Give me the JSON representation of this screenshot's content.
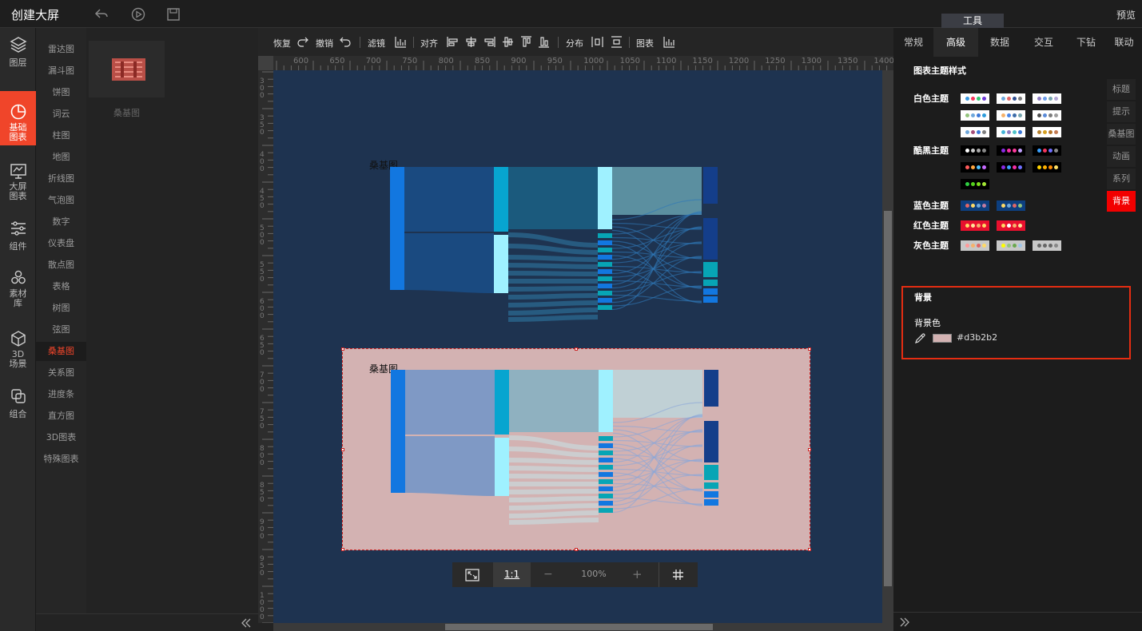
{
  "app": {
    "title": "创建大屏",
    "preview": "预览",
    "tool_tab": "工具"
  },
  "leftnav": [
    {
      "label": "图层",
      "icon": "layers-icon"
    },
    {
      "label": "基础图表",
      "icon": "pie-chart-icon"
    },
    {
      "label": "大屏图表",
      "icon": "monitor-chart-icon"
    },
    {
      "label": "组件",
      "icon": "sliders-icon"
    },
    {
      "label": "素材库",
      "icon": "hexagons-icon"
    },
    {
      "label": "3D场景",
      "icon": "cube-icon"
    },
    {
      "label": "组合",
      "icon": "group-icon"
    }
  ],
  "subnav": [
    "雷达图",
    "漏斗图",
    "饼图",
    "词云",
    "柱图",
    "地图",
    "折线图",
    "气泡图",
    "数字",
    "仪表盘",
    "散点图",
    "表格",
    "树图",
    "弦图",
    "桑基图",
    "关系图",
    "进度条",
    "直方图",
    "3D图表",
    "特殊图表"
  ],
  "subnav_active": "桑基图",
  "thumbnail": {
    "label": "桑基图"
  },
  "toolbar": {
    "redo": "恢复",
    "undo": "撤销",
    "filter": "滤镜",
    "align": "对齐",
    "distribute": "分布",
    "chart": "图表"
  },
  "ruler": {
    "top": [
      "600",
      "650",
      "700",
      "750",
      "800",
      "850",
      "900",
      "950",
      "1000",
      "1050",
      "1100",
      "1150",
      "1200",
      "1250",
      "1300",
      "1350",
      "1400"
    ],
    "left": [
      "300",
      "350",
      "400",
      "450",
      "500",
      "550",
      "600",
      "650",
      "700",
      "750",
      "800",
      "850",
      "900",
      "950",
      "1000"
    ]
  },
  "charts": [
    {
      "title": "桑基图"
    },
    {
      "title": "桑基图"
    }
  ],
  "zoom": {
    "ratio": "1:1",
    "minus": "−",
    "value": "100%",
    "plus": "+"
  },
  "right_tabs": [
    "常规",
    "高级",
    "数据",
    "交互",
    "下钻",
    "联动"
  ],
  "right_tab_active": "高级",
  "theme_section_title": "图表主题样式",
  "theme_groups": [
    {
      "label": "白色主题",
      "swatches": [
        [
          "#3b9ae1",
          "#f5365c",
          "#32c671",
          "#6e38d6"
        ],
        [
          "#6fa8dc",
          "#e06666",
          "#2e4d8f",
          "#7b7b7b"
        ],
        [
          "#8e7cc3",
          "#6d9eeb",
          "#76a5af",
          "#b4a7d6"
        ],
        [
          "#93c47d",
          "#6fa8dc",
          "#3c78d8",
          "#2d9cdb"
        ],
        [
          "#f6b26b",
          "#4a86e8",
          "#3d6ca8",
          "#76a5af"
        ],
        [
          "#4f4f4f",
          "#5b8bd8",
          "#7b7b7b",
          "#9e9e9e"
        ],
        [
          "#6fa8dc",
          "#a64d79",
          "#3c78d8",
          "#7f7f7f"
        ],
        [
          "#45b5d8",
          "#8e7cc3",
          "#4fc3c8",
          "#3c78d8"
        ],
        [
          "#b5812e",
          "#d5a021",
          "#b4742a",
          "#c27b54"
        ]
      ]
    },
    {
      "label": "酷黑主题",
      "swatches": [
        [
          "#ffffff",
          "#cccccc",
          "#aaaaaa",
          "#888888"
        ],
        [
          "#8a2be2",
          "#f52fa7",
          "#ff3b9d",
          "#c2a1ff"
        ],
        [
          "#3aa1ff",
          "#f5365c",
          "#6f6fff",
          "#888888"
        ],
        [
          "#ff5b5b",
          "#ffa640",
          "#4fc3ff",
          "#c86bff"
        ],
        [
          "#8a2be2",
          "#3aa1ff",
          "#f52fa7",
          "#6f6fff"
        ],
        [
          "#ffd400",
          "#ffb000",
          "#ff8a00",
          "#ffe066"
        ],
        [
          "#2ecc40",
          "#54d11c",
          "#7ddc1f",
          "#a3e635"
        ]
      ]
    },
    {
      "label": "蓝色主题",
      "swatches": [
        [
          "#e06666",
          "#ffd966",
          "#6fa8dc",
          "#c27ba0"
        ],
        [
          "#ffd966",
          "#6fa8dc",
          "#e06666",
          "#93c47d"
        ]
      ]
    },
    {
      "label": "红色主题",
      "swatches": [
        [
          "#ffd966",
          "#ffe599",
          "#f6b26b",
          "#ffd966"
        ],
        [
          "#ffd966",
          "#ffffff",
          "#f6b26b",
          "#ffe599"
        ]
      ]
    },
    {
      "label": "灰色主题",
      "swatches": [
        [
          "#ff9999",
          "#f6b26b",
          "#e06666",
          "#ffd966"
        ],
        [
          "#ffff00",
          "#93c47d",
          "#6aa84f",
          "#9fc5e8"
        ],
        [
          "#666666",
          "#666666",
          "#666666",
          "#888888"
        ]
      ]
    }
  ],
  "side_tabs": [
    "标题",
    "提示",
    "桑基图",
    "动画",
    "系列",
    "背景"
  ],
  "side_tab_active": "背景",
  "background": {
    "title": "背景",
    "color_label": "背景色",
    "color_value": "#d3b2b2"
  }
}
